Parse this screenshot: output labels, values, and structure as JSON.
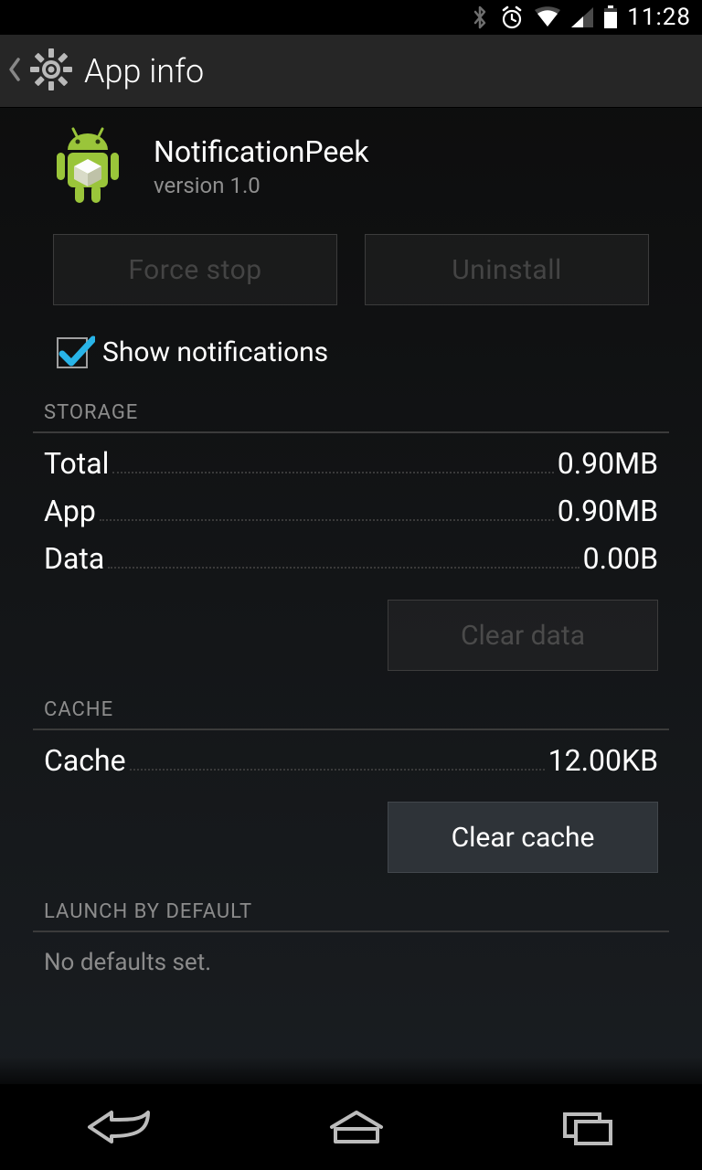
{
  "statusbar": {
    "time": "11:28"
  },
  "actionbar": {
    "title": "App info"
  },
  "app": {
    "name": "NotificationPeek",
    "version": "version 1.0"
  },
  "buttons": {
    "force_stop": "Force stop",
    "uninstall": "Uninstall",
    "clear_data": "Clear data",
    "clear_cache": "Clear cache"
  },
  "checkbox": {
    "show_notifications_label": "Show notifications",
    "checked": true
  },
  "sections": {
    "storage_header": "STORAGE",
    "cache_header": "CACHE",
    "launch_header": "LAUNCH BY DEFAULT"
  },
  "storage": {
    "total_label": "Total",
    "total_value": "0.90MB",
    "app_label": "App",
    "app_value": "0.90MB",
    "data_label": "Data",
    "data_value": "0.00B"
  },
  "cache": {
    "cache_label": "Cache",
    "cache_value": "12.00KB"
  },
  "launch": {
    "no_defaults": "No defaults set."
  }
}
